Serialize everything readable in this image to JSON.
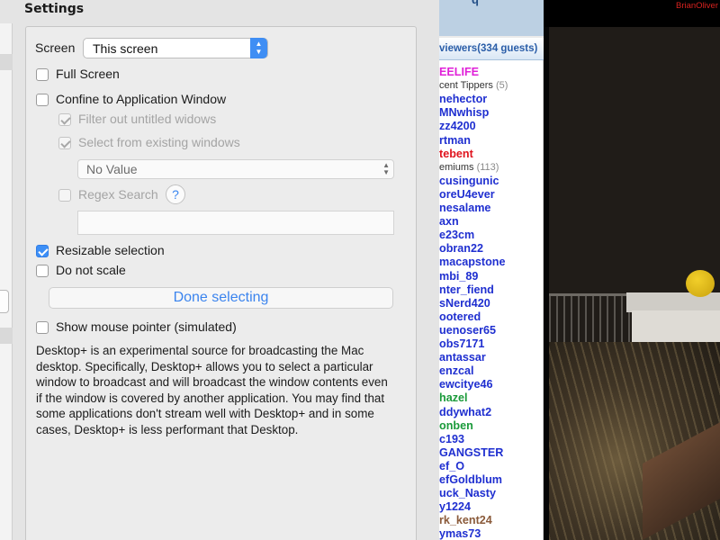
{
  "settings": {
    "title": "Settings",
    "screen": {
      "label": "Screen",
      "value": "This screen"
    },
    "full_screen": {
      "label": "Full Screen",
      "checked": false
    },
    "confine": {
      "label": "Confine to Application Window",
      "checked": false
    },
    "filter_untitled": {
      "label": "Filter out untitled widows",
      "checked": true,
      "enabled": false
    },
    "select_existing": {
      "label": "Select from existing windows",
      "checked": true,
      "enabled": false
    },
    "window_select": {
      "value": "No Value"
    },
    "regex": {
      "label": "Regex Search",
      "checked": false,
      "enabled": false,
      "help": "?",
      "value": ""
    },
    "resizable": {
      "label": "Resizable selection",
      "checked": true
    },
    "no_scale": {
      "label": "Do not scale",
      "checked": false
    },
    "done_button": "Done selecting",
    "mouse_pointer": {
      "label": "Show mouse pointer (simulated)",
      "checked": false
    },
    "description": "Desktop+ is an experimental source for broadcasting the Mac desktop.  Specifically, Desktop+ allows you to select a particular window to broadcast and will broadcast the window contents even if the window is covered by another application.  You may find that some applications don't stream well with Desktop+ and in some cases, Desktop+ is less performant that Desktop."
  },
  "viewers": {
    "top_fragment": "q",
    "header": "viewers(334 guests)",
    "items": [
      {
        "name": "EELIFE",
        "color": "#e020d8"
      },
      {
        "name": "cent Tippers",
        "count": "(5)",
        "color": "#333333",
        "section": true
      },
      {
        "name": "nehector",
        "color": "#1f2fd0"
      },
      {
        "name": "MNwhisp",
        "color": "#1f2fd0"
      },
      {
        "name": "zz4200",
        "color": "#1f2fd0"
      },
      {
        "name": "rtman",
        "color": "#1f2fd0"
      },
      {
        "name": "tebent",
        "color": "#e0141e"
      },
      {
        "name": "emiums",
        "count": "(113)",
        "color": "#333333",
        "section": true
      },
      {
        "name": "cusingunic",
        "color": "#1f2fd0"
      },
      {
        "name": "oreU4ever",
        "color": "#1f2fd0"
      },
      {
        "name": "nesalame",
        "color": "#1f2fd0"
      },
      {
        "name": "axn",
        "color": "#1f2fd0"
      },
      {
        "name": "e23cm",
        "color": "#1f2fd0"
      },
      {
        "name": "obran22",
        "color": "#1f2fd0"
      },
      {
        "name": "macapstone",
        "color": "#1f2fd0"
      },
      {
        "name": "mbi_89",
        "color": "#1f2fd0"
      },
      {
        "name": "nter_fiend",
        "color": "#1f2fd0"
      },
      {
        "name": "sNerd420",
        "color": "#1f2fd0"
      },
      {
        "name": "ootered",
        "color": "#1f2fd0"
      },
      {
        "name": "uenoser65",
        "color": "#1f2fd0"
      },
      {
        "name": "obs7171",
        "color": "#1f2fd0"
      },
      {
        "name": "antassar",
        "color": "#1f2fd0"
      },
      {
        "name": "enzcal",
        "color": "#1f2fd0"
      },
      {
        "name": "ewcitye46",
        "color": "#1f2fd0"
      },
      {
        "name": "hazel",
        "color": "#1a9a3a"
      },
      {
        "name": "ddywhat2",
        "color": "#1f2fd0"
      },
      {
        "name": "onben",
        "color": "#1a9a3a"
      },
      {
        "name": "c193",
        "color": "#1f2fd0"
      },
      {
        "name": "GANGSTER",
        "color": "#1f2fd0"
      },
      {
        "name": "ef_O",
        "color": "#1f2fd0"
      },
      {
        "name": "efGoldblum",
        "color": "#1f2fd0"
      },
      {
        "name": "uck_Nasty",
        "color": "#1f2fd0"
      },
      {
        "name": "y1224",
        "color": "#1f2fd0"
      },
      {
        "name": "rk_kent24",
        "color": "#8a5a3a"
      },
      {
        "name": "ymas73",
        "color": "#1f2fd0"
      }
    ]
  },
  "video": {
    "watermark": "BrianOliver"
  }
}
